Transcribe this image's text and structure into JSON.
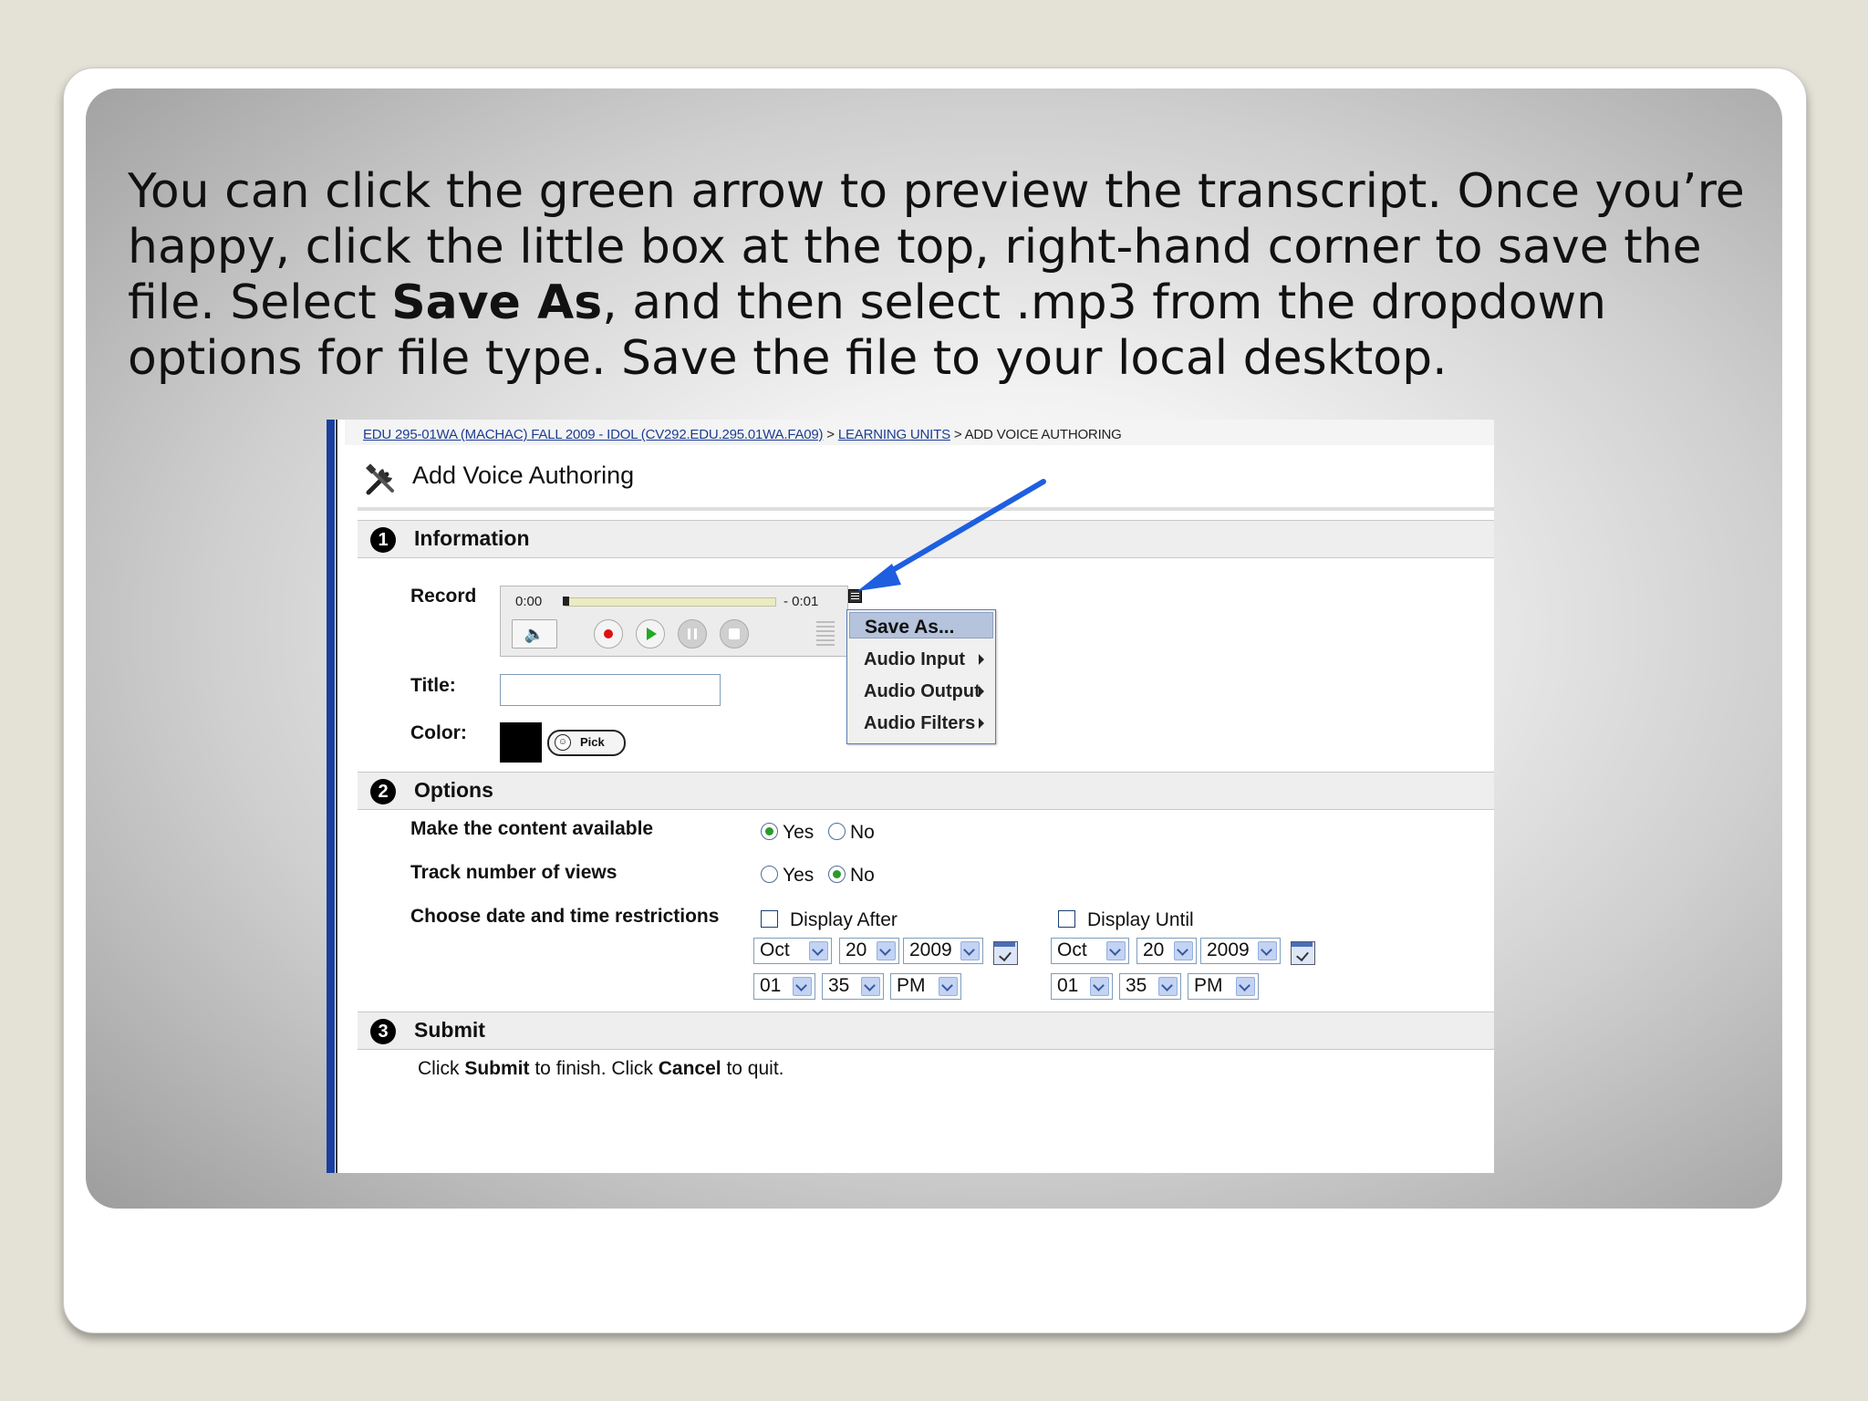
{
  "caption": {
    "part1": "You can click the green arrow to preview the transcript.  Once you’re happy, click the little box at the top, right-hand corner to save the file.  Select ",
    "bold": "Save As",
    "part2": ", and then select .mp3 from the dropdown options for file type.  Save the file to your local desktop."
  },
  "breadcrumb": {
    "course": "EDU 295-01WA (MACHAC) FALL 2009 - IDOL (CV292.EDU.295.01WA.FA09)",
    "sep1": " > ",
    "units": "LEARNING UNITS",
    "sep2": " > ",
    "current": "ADD VOICE AUTHORING"
  },
  "page_title": "Add Voice Authoring",
  "sections": {
    "information": {
      "num": "1",
      "title": "Information"
    },
    "options": {
      "num": "2",
      "title": "Options"
    },
    "submit": {
      "num": "3",
      "title": "Submit"
    }
  },
  "record": {
    "label": "Record",
    "time_start": "0:00",
    "time_end": "- 0:01",
    "progress": 0
  },
  "context_menu": {
    "items": [
      {
        "label": "Save As...",
        "submenu": false,
        "selected": true
      },
      {
        "label": "Audio Input",
        "submenu": true
      },
      {
        "label": "Audio Output",
        "submenu": true
      },
      {
        "label": "Audio Filters",
        "submenu": true
      }
    ]
  },
  "title_field": {
    "label": "Title:",
    "value": ""
  },
  "color_field": {
    "label": "Color:",
    "swatch": "#000000",
    "pick_label": "Pick"
  },
  "options": {
    "available": {
      "label": "Make the content available",
      "yes": "Yes",
      "no": "No",
      "selected": "Yes"
    },
    "track": {
      "label": "Track number of views",
      "yes": "Yes",
      "no": "No",
      "selected": "No"
    },
    "date": {
      "label": "Choose date and time restrictions",
      "after": {
        "label": "Display After",
        "checked": false,
        "month": "Oct",
        "day": "20",
        "year": "2009",
        "hour": "01",
        "minute": "35",
        "ampm": "PM"
      },
      "until": {
        "label": "Display Until",
        "checked": false,
        "month": "Oct",
        "day": "20",
        "year": "2009",
        "hour": "01",
        "minute": "35",
        "ampm": "PM"
      }
    }
  },
  "submit": {
    "t1": "Click ",
    "b1": "Submit",
    "t2": " to finish. Click ",
    "b2": "Cancel",
    "t3": " to quit."
  },
  "colors": {
    "accent_arrow": "#1e5fe0",
    "left_bar": "#1a3f9e",
    "menu_highlight": "#b5c3dc"
  }
}
